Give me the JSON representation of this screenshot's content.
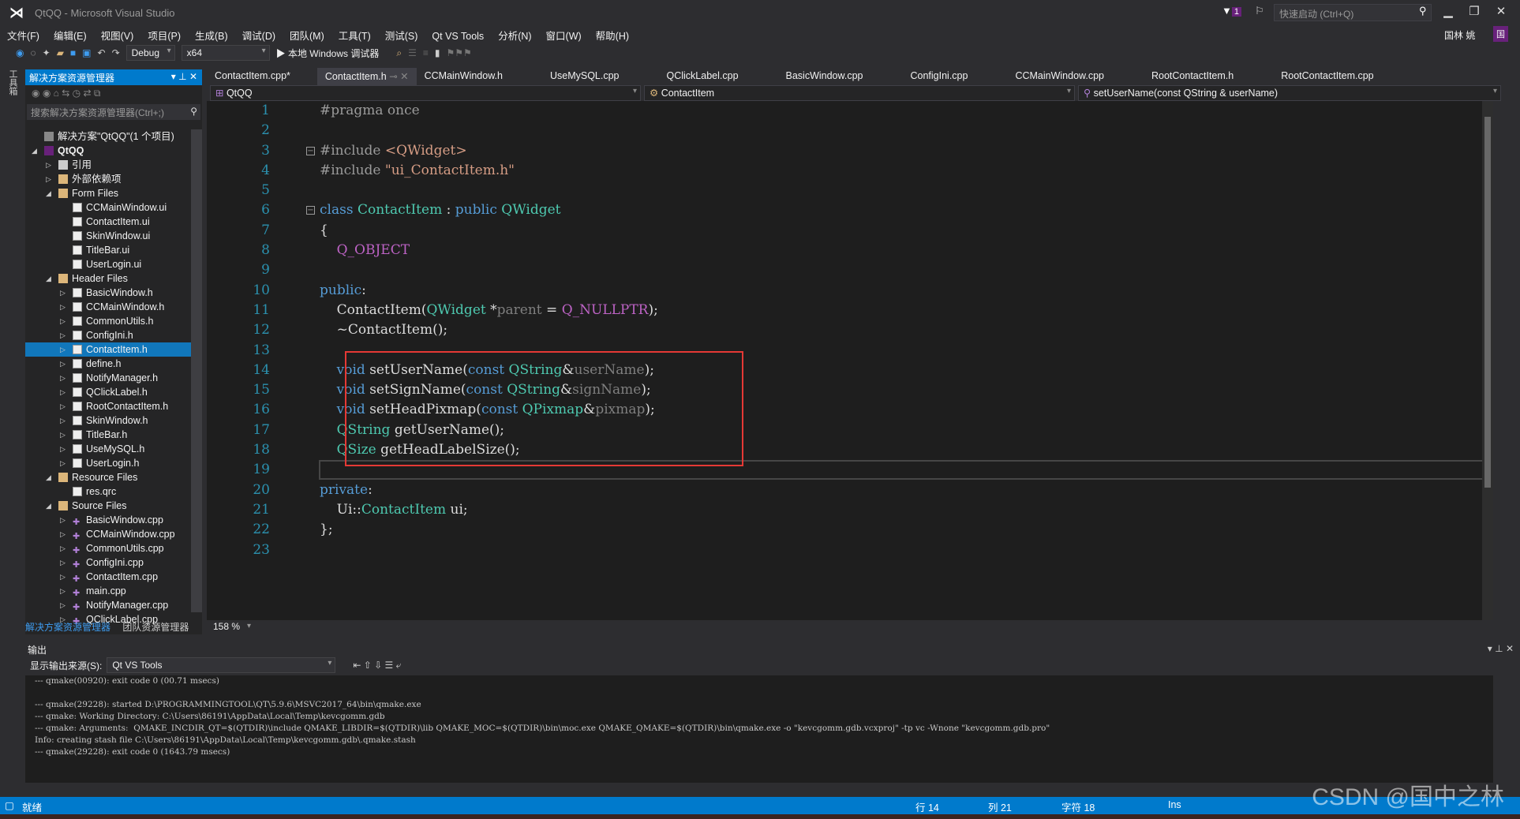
{
  "window": {
    "title": "QtQQ - Microsoft Visual Studio",
    "quick_launch_placeholder": "快速启动 (Ctrl+Q)",
    "notifications": "1",
    "user": "国林 姚",
    "user_badge": "国"
  },
  "menu": [
    "文件(F)",
    "编辑(E)",
    "视图(V)",
    "项目(P)",
    "生成(B)",
    "调试(D)",
    "团队(M)",
    "工具(T)",
    "测试(S)",
    "Qt VS Tools",
    "分析(N)",
    "窗口(W)",
    "帮助(H)"
  ],
  "toolbar": {
    "config": "Debug",
    "platform": "x64",
    "run": "▶ 本地 Windows 调试器"
  },
  "left_strip_label": "工具箱",
  "solution_explorer": {
    "title": "解决方案资源管理器",
    "search_placeholder": "搜索解决方案资源管理器(Ctrl+;)",
    "items": [
      {
        "label": "解决方案\"QtQQ\"(1 个项目)",
        "level": 0,
        "icon": "sol",
        "arrow": ""
      },
      {
        "label": "QtQQ",
        "level": 0,
        "icon": "proj",
        "arrow": "◢",
        "bold": true
      },
      {
        "label": "引用",
        "level": 1,
        "icon": "ref",
        "arrow": "▷"
      },
      {
        "label": "外部依赖项",
        "level": 1,
        "icon": "folder",
        "arrow": "▷"
      },
      {
        "label": "Form Files",
        "level": 1,
        "icon": "folder",
        "arrow": "◢"
      },
      {
        "label": "CCMainWindow.ui",
        "level": 2,
        "icon": "file",
        "arrow": ""
      },
      {
        "label": "ContactItem.ui",
        "level": 2,
        "icon": "file",
        "arrow": ""
      },
      {
        "label": "SkinWindow.ui",
        "level": 2,
        "icon": "file",
        "arrow": ""
      },
      {
        "label": "TitleBar.ui",
        "level": 2,
        "icon": "file",
        "arrow": ""
      },
      {
        "label": "UserLogin.ui",
        "level": 2,
        "icon": "file",
        "arrow": ""
      },
      {
        "label": "Header Files",
        "level": 1,
        "icon": "folder",
        "arrow": "◢"
      },
      {
        "label": "BasicWindow.h",
        "level": 2,
        "icon": "file",
        "arrow": "▷"
      },
      {
        "label": "CCMainWindow.h",
        "level": 2,
        "icon": "file",
        "arrow": "▷"
      },
      {
        "label": "CommonUtils.h",
        "level": 2,
        "icon": "file",
        "arrow": "▷"
      },
      {
        "label": "ConfigIni.h",
        "level": 2,
        "icon": "file",
        "arrow": "▷"
      },
      {
        "label": "ContactItem.h",
        "level": 2,
        "icon": "file",
        "arrow": "▷",
        "selected": true
      },
      {
        "label": "define.h",
        "level": 2,
        "icon": "file",
        "arrow": "▷"
      },
      {
        "label": "NotifyManager.h",
        "level": 2,
        "icon": "file",
        "arrow": "▷"
      },
      {
        "label": "QClickLabel.h",
        "level": 2,
        "icon": "file",
        "arrow": "▷"
      },
      {
        "label": "RootContactItem.h",
        "level": 2,
        "icon": "file",
        "arrow": "▷"
      },
      {
        "label": "SkinWindow.h",
        "level": 2,
        "icon": "file",
        "arrow": "▷"
      },
      {
        "label": "TitleBar.h",
        "level": 2,
        "icon": "file",
        "arrow": "▷"
      },
      {
        "label": "UseMySQL.h",
        "level": 2,
        "icon": "file",
        "arrow": "▷"
      },
      {
        "label": "UserLogin.h",
        "level": 2,
        "icon": "file",
        "arrow": "▷"
      },
      {
        "label": "Resource Files",
        "level": 1,
        "icon": "folder",
        "arrow": "◢"
      },
      {
        "label": "res.qrc",
        "level": 2,
        "icon": "file",
        "arrow": ""
      },
      {
        "label": "Source Files",
        "level": 1,
        "icon": "folder",
        "arrow": "◢"
      },
      {
        "label": "BasicWindow.cpp",
        "level": 2,
        "icon": "cpp",
        "arrow": "▷"
      },
      {
        "label": "CCMainWindow.cpp",
        "level": 2,
        "icon": "cpp",
        "arrow": "▷"
      },
      {
        "label": "CommonUtils.cpp",
        "level": 2,
        "icon": "cpp",
        "arrow": "▷"
      },
      {
        "label": "ConfigIni.cpp",
        "level": 2,
        "icon": "cpp",
        "arrow": "▷"
      },
      {
        "label": "ContactItem.cpp",
        "level": 2,
        "icon": "cpp",
        "arrow": "▷"
      },
      {
        "label": "main.cpp",
        "level": 2,
        "icon": "cpp",
        "arrow": "▷"
      },
      {
        "label": "NotifyManager.cpp",
        "level": 2,
        "icon": "cpp",
        "arrow": "▷"
      },
      {
        "label": "QClickLabel.cpp",
        "level": 2,
        "icon": "cpp",
        "arrow": "▷"
      }
    ],
    "bottom_tabs": [
      "解决方案资源管理器",
      "团队资源管理器"
    ]
  },
  "tabs": [
    {
      "label": "ContactItem.cpp*"
    },
    {
      "label": "ContactItem.h",
      "active": true
    },
    {
      "label": "CCMainWindow.h"
    },
    {
      "label": "UseMySQL.cpp"
    },
    {
      "label": "QClickLabel.cpp"
    },
    {
      "label": "BasicWindow.cpp"
    },
    {
      "label": "ConfigIni.cpp"
    },
    {
      "label": "CCMainWindow.cpp"
    },
    {
      "label": "RootContactItem.h"
    },
    {
      "label": "RootContactItem.cpp"
    }
  ],
  "navbar": {
    "project": "QtQQ",
    "scope": "ContactItem",
    "member": "setUserName(const QString & userName)"
  },
  "code": [
    [
      [
        "#pragma once",
        "pp"
      ]
    ],
    [],
    [
      [
        "#include ",
        "pp"
      ],
      [
        "<QWidget>",
        "str"
      ]
    ],
    [
      [
        "#include ",
        "pp"
      ],
      [
        "\"ui_ContactItem.h\"",
        "str"
      ]
    ],
    [],
    [
      [
        "class ",
        "kw"
      ],
      [
        "ContactItem",
        "ty"
      ],
      [
        " : ",
        ""
      ],
      [
        "public ",
        "kw"
      ],
      [
        "QWidget",
        "ty"
      ]
    ],
    [
      [
        "{",
        ""
      ]
    ],
    [
      [
        "    ",
        ""
      ],
      [
        "Q_OBJECT",
        "mac"
      ]
    ],
    [],
    [
      [
        "public",
        "kw"
      ],
      [
        ":",
        ""
      ]
    ],
    [
      [
        "    ContactItem(",
        ""
      ],
      [
        "QWidget",
        "ty"
      ],
      [
        " *",
        ""
      ],
      [
        "parent",
        "par"
      ],
      [
        " = ",
        ""
      ],
      [
        "Q_NULLPTR",
        "mac"
      ],
      [
        ");",
        ""
      ]
    ],
    [
      [
        "    ~ContactItem();",
        ""
      ]
    ],
    [],
    [
      [
        "    ",
        ""
      ],
      [
        "void ",
        "kw"
      ],
      [
        "setUserName(",
        ""
      ],
      [
        "const ",
        "kw"
      ],
      [
        "QString",
        "ty"
      ],
      [
        "&",
        ""
      ],
      [
        "userName",
        "par"
      ],
      [
        ");",
        ""
      ]
    ],
    [
      [
        "    ",
        ""
      ],
      [
        "void ",
        "kw"
      ],
      [
        "setSignName(",
        ""
      ],
      [
        "const ",
        "kw"
      ],
      [
        "QString",
        "ty"
      ],
      [
        "&",
        ""
      ],
      [
        "signName",
        "par"
      ],
      [
        ");",
        ""
      ]
    ],
    [
      [
        "    ",
        ""
      ],
      [
        "void ",
        "kw"
      ],
      [
        "setHeadPixmap(",
        ""
      ],
      [
        "const ",
        "kw"
      ],
      [
        "QPixmap",
        "ty"
      ],
      [
        "&",
        ""
      ],
      [
        "pixmap",
        "par"
      ],
      [
        ");",
        ""
      ]
    ],
    [
      [
        "    ",
        ""
      ],
      [
        "QString",
        "ty"
      ],
      [
        " getUserName();",
        ""
      ]
    ],
    [
      [
        "    ",
        ""
      ],
      [
        "QSize",
        "ty"
      ],
      [
        " getHeadLabelSize();",
        ""
      ]
    ],
    [],
    [
      [
        "private",
        "kw"
      ],
      [
        ":",
        ""
      ]
    ],
    [
      [
        "    Ui::",
        ""
      ],
      [
        "ContactItem",
        "ty"
      ],
      [
        " ui;",
        ""
      ]
    ],
    [
      [
        "};",
        ""
      ]
    ],
    []
  ],
  "zoom": "158 %",
  "output": {
    "title": "输出",
    "source_label": "显示输出来源(S):",
    "source_value": "Qt VS Tools",
    "lines": [
      "--- qmake(00920): exit code 0 (00.71 msecs)",
      "",
      "--- qmake(29228): started D:\\PROGRAMMINGTOOL\\QT\\5.9.6\\MSVC2017_64\\bin\\qmake.exe",
      "--- qmake: Working Directory: C:\\Users\\86191\\AppData\\Local\\Temp\\kevcgomm.gdb",
      "--- qmake: Arguments:  QMAKE_INCDIR_QT=$(QTDIR)\\include QMAKE_LIBDIR=$(QTDIR)\\lib QMAKE_MOC=$(QTDIR)\\bin\\moc.exe QMAKE_QMAKE=$(QTDIR)\\bin\\qmake.exe -o \"kevcgomm.gdb.vcxproj\" -tp vc -Wnone \"kevcgomm.gdb.pro\"",
      "Info: creating stash file C:\\Users\\86191\\AppData\\Local\\Temp\\kevcgomm.gdb\\.qmake.stash",
      "--- qmake(29228): exit code 0 (1643.79 msecs)"
    ]
  },
  "status": {
    "ready": "就绪",
    "line": "行 14",
    "col": "列 21",
    "char": "字符 18",
    "mode": "Ins"
  },
  "watermark": "CSDN @国中之林",
  "colors": {
    "accent": "#007acc",
    "highlight_box": "#e53935",
    "editor_bg": "#1e1e1e"
  }
}
